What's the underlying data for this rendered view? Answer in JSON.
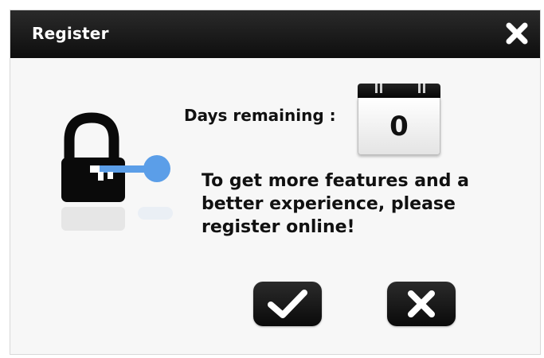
{
  "window": {
    "title": "Register"
  },
  "status": {
    "days_label": "Days remaining :",
    "days_value": "0"
  },
  "message": "To get more features and a better experience, please register online!",
  "buttons": {
    "confirm_icon": "check-icon",
    "cancel_icon": "x-icon"
  },
  "icons": {
    "close": "close-icon",
    "illustration": "lock-key-icon",
    "calendar": "calendar-icon"
  },
  "colors": {
    "titlebar": "#0e0e0e",
    "key_blue": "#5b9ee8",
    "button_dark": "#111111"
  }
}
